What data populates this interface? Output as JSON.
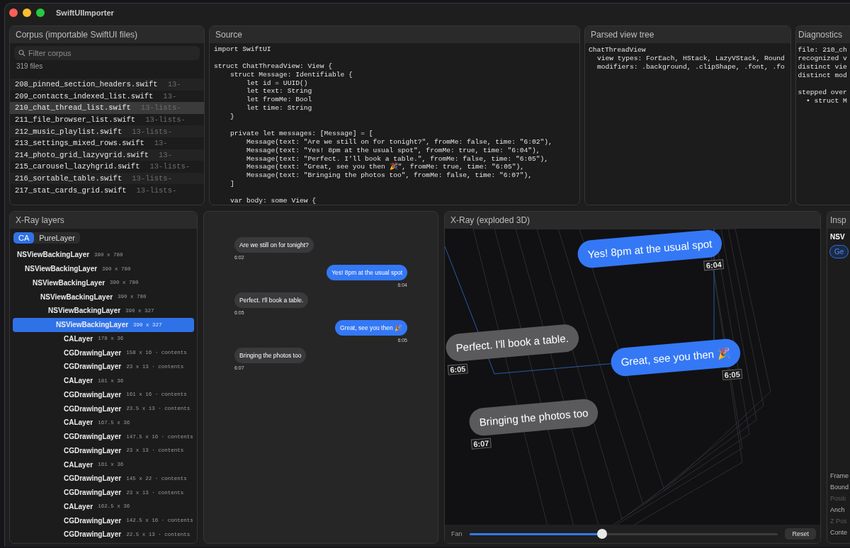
{
  "window": {
    "title": "SwiftUIImporter"
  },
  "corpus": {
    "title": "Corpus (importable SwiftUI files)",
    "search": {
      "placeholder": "Filter corpus"
    },
    "count": "319 files",
    "files": [
      {
        "name": "208_pinned_section_headers.swift",
        "tag": "13-",
        "selected": false
      },
      {
        "name": "209_contacts_indexed_list.swift",
        "tag": "13-",
        "selected": false
      },
      {
        "name": "210_chat_thread_list.swift",
        "tag": "13-lists-",
        "selected": true
      },
      {
        "name": "211_file_browser_list.swift",
        "tag": "13-lists-",
        "selected": false
      },
      {
        "name": "212_music_playlist.swift",
        "tag": "13-lists-",
        "selected": false
      },
      {
        "name": "213_settings_mixed_rows.swift",
        "tag": "13-",
        "selected": false
      },
      {
        "name": "214_photo_grid_lazyvgrid.swift",
        "tag": "13-",
        "selected": false
      },
      {
        "name": "215_carousel_lazyhgrid.swift",
        "tag": "13-lists-",
        "selected": false
      },
      {
        "name": "216_sortable_table.swift",
        "tag": "13-lists-",
        "selected": false
      },
      {
        "name": "217_stat_cards_grid.swift",
        "tag": "13-lists-",
        "selected": false
      }
    ]
  },
  "source": {
    "title": "Source",
    "blocks": [
      [
        "import SwiftUI"
      ],
      [
        "struct ChatThreadView: View {",
        "    struct Message: Identifiable {",
        "        let id = UUID()",
        "        let text: String",
        "        let fromMe: Bool",
        "        let time: String",
        "    }"
      ],
      [
        "    private let messages: [Message] = [",
        "        Message(text: \"Are we still on for tonight?\", fromMe: false, time: \"6:02\"),",
        "        Message(text: \"Yes! 8pm at the usual spot\", fromMe: true, time: \"6:04\"),",
        "        Message(text: \"Perfect. I'll book a table.\", fromMe: false, time: \"6:05\"),",
        "        Message(text: \"Great, see you then 🎉\", fromMe: true, time: \"6:05\"),",
        "        Message(text: \"Bringing the photos too\", fromMe: false, time: \"6:07\"),",
        "    ]"
      ],
      [
        "    var body: some View {"
      ]
    ]
  },
  "parsed_tree": {
    "title": "Parsed view tree",
    "nodes": [
      {
        "label": "ChatThreadView",
        "children": [
          {
            "label": "view types: ForEach, HStack, LazyVStack, Round"
          },
          {
            "label": "modifiers: .background, .clipShape, .font, .fo"
          }
        ]
      }
    ]
  },
  "diagnostics": {
    "title": "Diagnostics",
    "sections": [
      {
        "lines": [
          "file: 210_ch",
          "recognized v",
          "distinct vie",
          "distinct mod"
        ]
      },
      {
        "lines": [
          "stepped over",
          "  • struct M"
        ]
      }
    ]
  },
  "xray_layers": {
    "title": "X-Ray layers",
    "tabs": [
      {
        "label": "CA",
        "selected": true
      },
      {
        "label": "PureLayer",
        "selected": false
      }
    ],
    "tree": [
      {
        "name": "NSViewBackingLayer",
        "size": "390 x 780",
        "selected": false,
        "children": [
          {
            "name": "NSViewBackingLayer",
            "size": "390 x 780",
            "selected": false,
            "children": [
              {
                "name": "NSViewBackingLayer",
                "size": "390 x 780",
                "selected": false,
                "children": [
                  {
                    "name": "NSViewBackingLayer",
                    "size": "390 x 780",
                    "selected": false,
                    "children": [
                      {
                        "name": "NSViewBackingLayer",
                        "size": "390 x 327",
                        "selected": false,
                        "children": [
                          {
                            "name": "NSViewBackingLayer",
                            "size": "390 x 327",
                            "selected": true,
                            "children": [
                              {
                                "name": "CALayer",
                                "size": "178 x 36",
                                "selected": false
                              },
                              {
                                "name": "CGDrawingLayer",
                                "size": "158 x 16 · contents",
                                "selected": false
                              },
                              {
                                "name": "CGDrawingLayer",
                                "size": "23 x 13 · contents",
                                "selected": false
                              },
                              {
                                "name": "CALayer",
                                "size": "181 x 36",
                                "selected": false
                              },
                              {
                                "name": "CGDrawingLayer",
                                "size": "161 x 16 · contents",
                                "selected": false
                              },
                              {
                                "name": "CGDrawingLayer",
                                "size": "23.5 x 13 · contents",
                                "selected": false
                              },
                              {
                                "name": "CALayer",
                                "size": "167.5 x 36",
                                "selected": false
                              },
                              {
                                "name": "CGDrawingLayer",
                                "size": "147.5 x 16 · contents",
                                "selected": false
                              },
                              {
                                "name": "CGDrawingLayer",
                                "size": "23 x 13 · contents",
                                "selected": false
                              },
                              {
                                "name": "CALayer",
                                "size": "161 x 36",
                                "selected": false
                              },
                              {
                                "name": "CGDrawingLayer",
                                "size": "145 x 22 · contents",
                                "selected": false
                              },
                              {
                                "name": "CGDrawingLayer",
                                "size": "23 x 13 · contents",
                                "selected": false
                              },
                              {
                                "name": "CALayer",
                                "size": "162.5 x 36",
                                "selected": false
                              },
                              {
                                "name": "CGDrawingLayer",
                                "size": "142.5 x 16 · contents",
                                "selected": false
                              },
                              {
                                "name": "CGDrawingLayer",
                                "size": "22.5 x 13 · contents",
                                "selected": false
                              }
                            ]
                          }
                        ]
                      }
                    ]
                  }
                ]
              }
            ]
          }
        ]
      }
    ]
  },
  "preview": {
    "messages": [
      {
        "text": "Are we still on for tonight?",
        "time": "6:02",
        "from_me": false
      },
      {
        "text": "Yes! 8pm at the usual spot",
        "time": "6:04",
        "from_me": true
      },
      {
        "text": "Perfect. I'll book a table.",
        "time": "6:05",
        "from_me": false
      },
      {
        "text": "Great, see you then 🎉",
        "time": "6:05",
        "from_me": true
      },
      {
        "text": "Bringing the photos too",
        "time": "6:07",
        "from_me": false
      }
    ]
  },
  "xray_3d": {
    "title": "X-Ray (exploded 3D)",
    "messages": [
      {
        "text": "Yes! 8pm at the usual spot",
        "time": "6:04",
        "from_me": true
      },
      {
        "text": "Perfect. I'll book a table.",
        "time": "6:05",
        "from_me": false
      },
      {
        "text": "Great, see you then 🎉",
        "time": "6:05",
        "from_me": true
      },
      {
        "text": "Bringing the photos too",
        "time": "6:07",
        "from_me": false
      }
    ],
    "fan": {
      "label": "Fan",
      "level": 0.43
    },
    "reset": "Reset"
  },
  "inspector": {
    "title": "Insp",
    "layer": "NSV",
    "button": "Ge",
    "properties": [
      {
        "label": "Frame",
        "disabled": false
      },
      {
        "label": "Bound",
        "disabled": false
      },
      {
        "label": "Positi",
        "disabled": true
      },
      {
        "label": "Anch",
        "disabled": false
      },
      {
        "label": "Z Pos",
        "disabled": true
      },
      {
        "label": "Conte",
        "disabled": false
      }
    ]
  }
}
